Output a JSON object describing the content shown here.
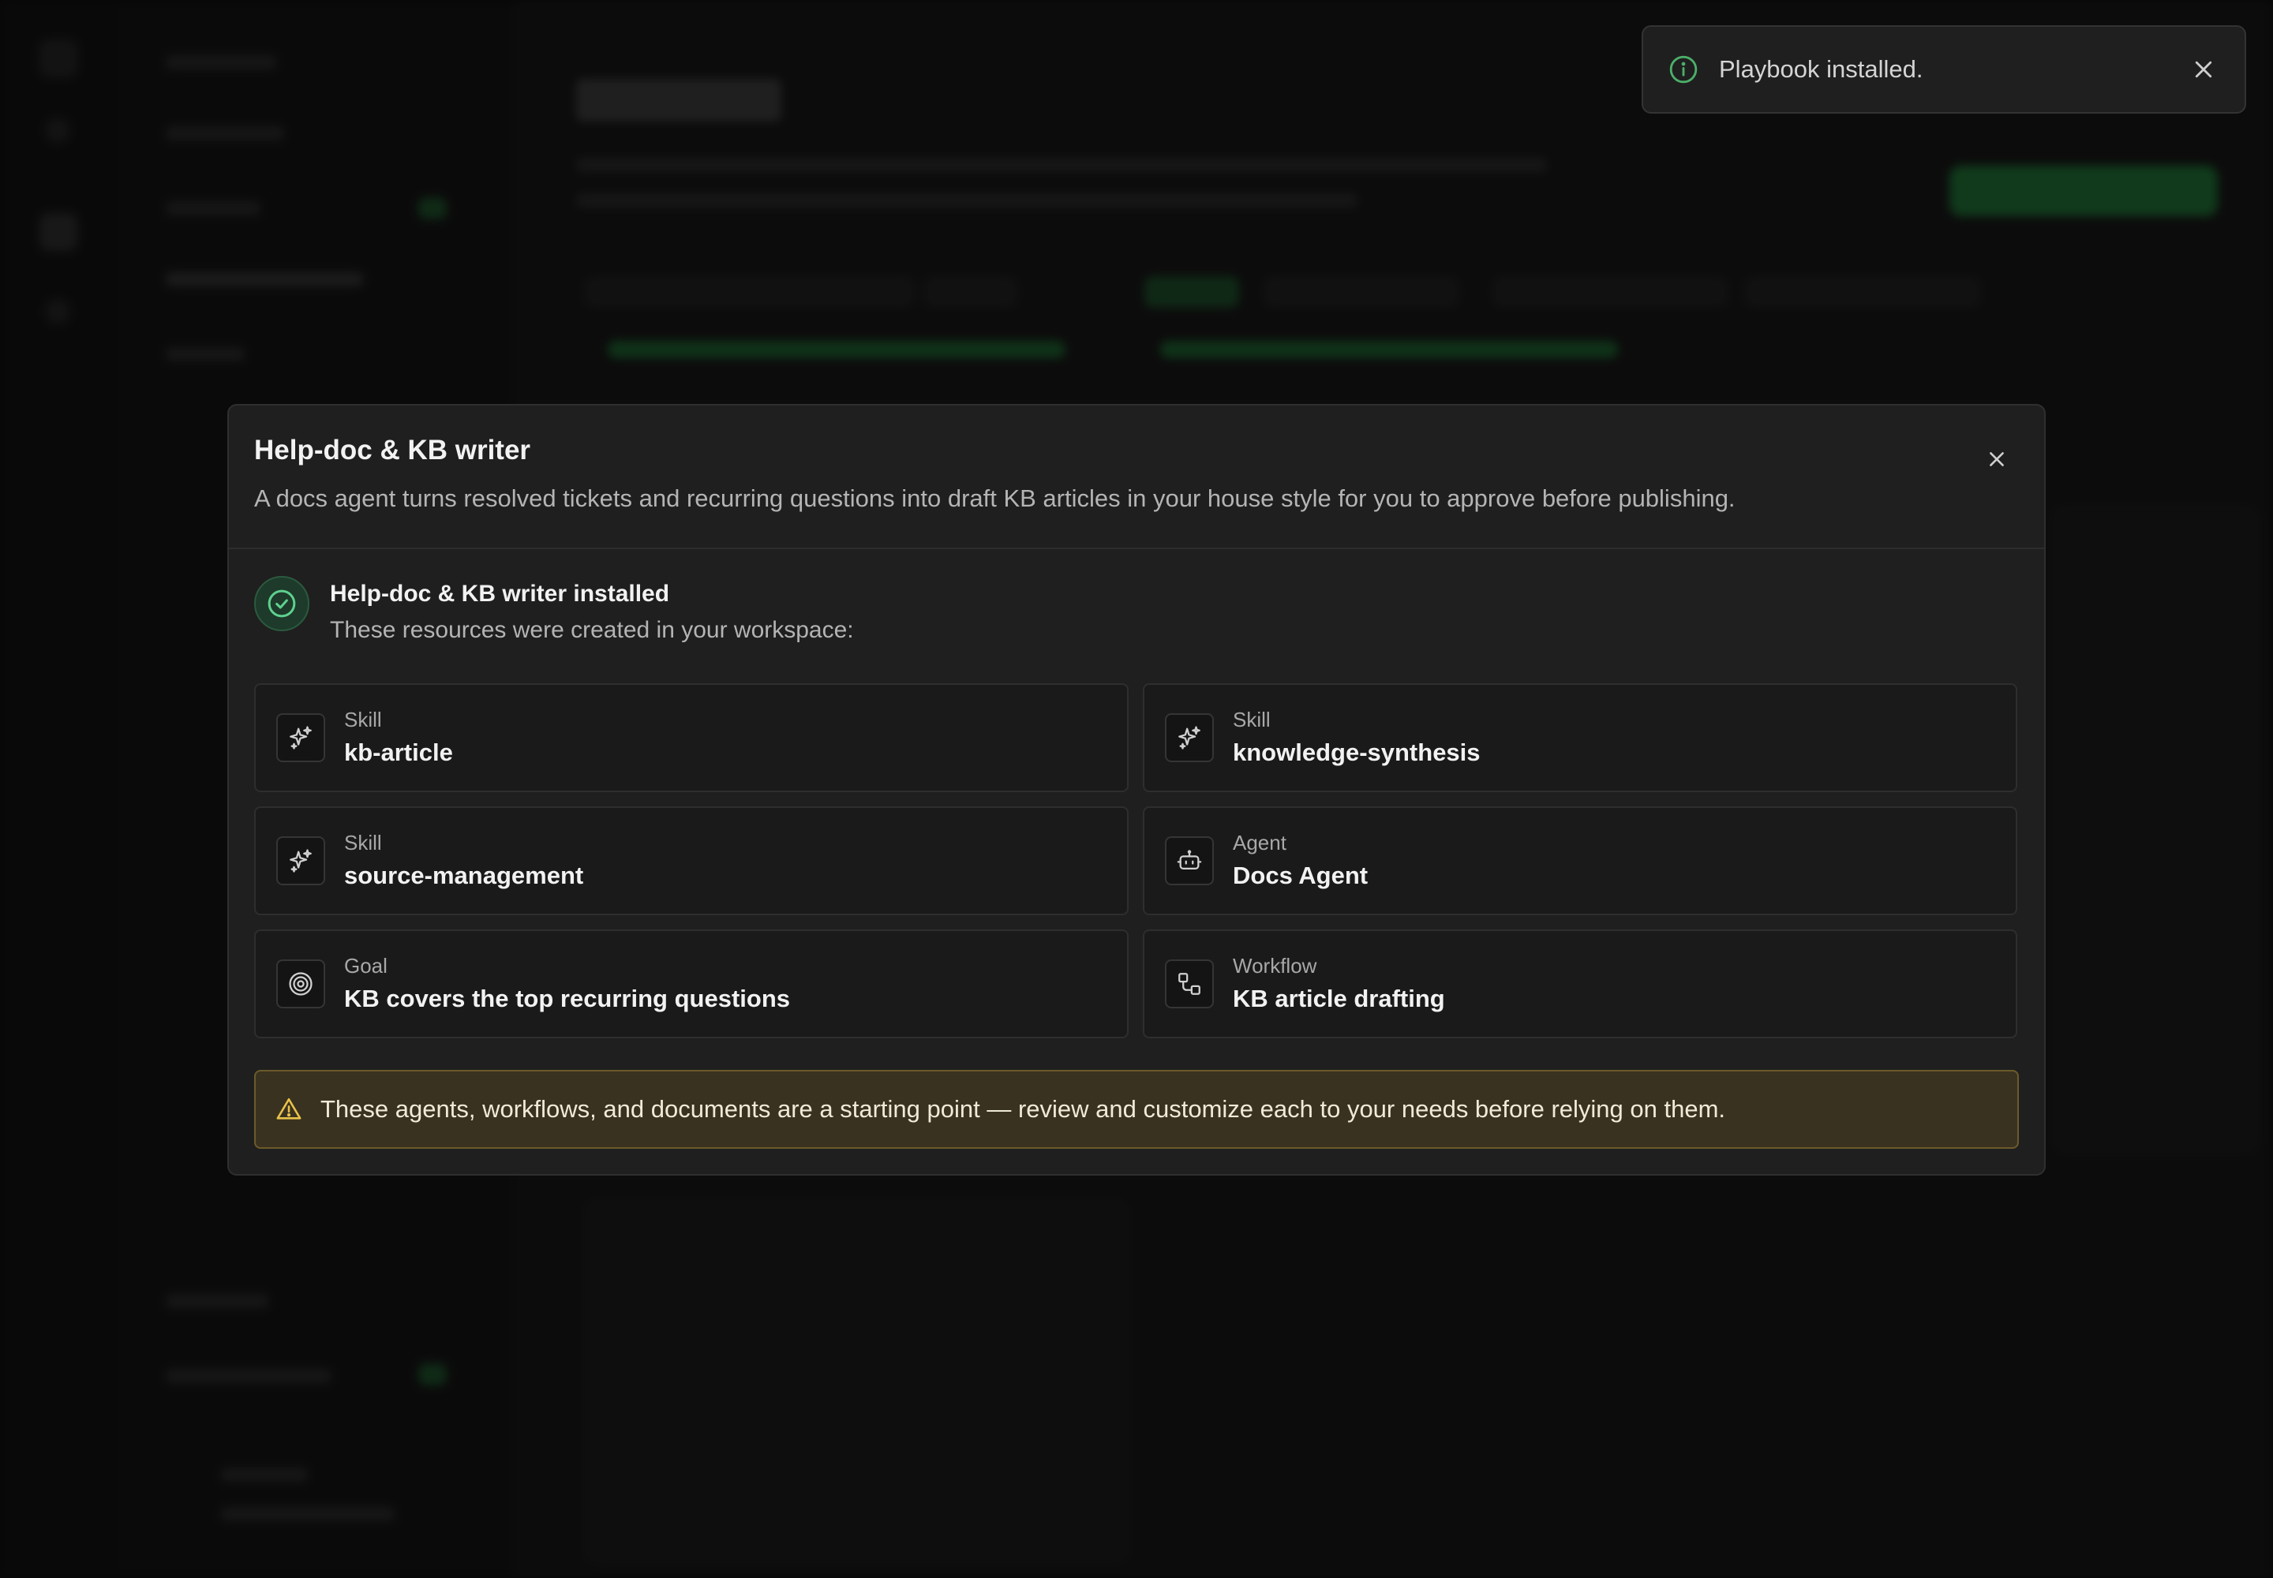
{
  "toast": {
    "message": "Playbook installed.",
    "icon": "info-circle-icon",
    "icon_color": "#4caf6a"
  },
  "modal": {
    "title": "Help-doc & KB writer",
    "description": "A docs agent turns resolved tickets and recurring questions into draft KB articles in your house style for you to approve before publishing.",
    "installed": {
      "title": "Help-doc & KB writer installed",
      "subtitle": "These resources were created in your workspace:",
      "icon": "check-circle-icon",
      "accent": "#5fd08f"
    },
    "resources": [
      {
        "type": "Skill",
        "name": "kb-article",
        "icon": "sparkles-icon"
      },
      {
        "type": "Skill",
        "name": "knowledge-synthesis",
        "icon": "sparkles-icon"
      },
      {
        "type": "Skill",
        "name": "source-management",
        "icon": "sparkles-icon"
      },
      {
        "type": "Agent",
        "name": "Docs Agent",
        "icon": "robot-icon"
      },
      {
        "type": "Goal",
        "name": "KB covers the top recurring questions",
        "icon": "target-icon"
      },
      {
        "type": "Workflow",
        "name": "KB article drafting",
        "icon": "workflow-icon"
      }
    ],
    "warning": {
      "text": "These agents, workflows, and documents are a starting point — review and customize each to your needs before relying on them.",
      "icon": "warning-triangle-icon",
      "color": "#e8c24a"
    }
  }
}
